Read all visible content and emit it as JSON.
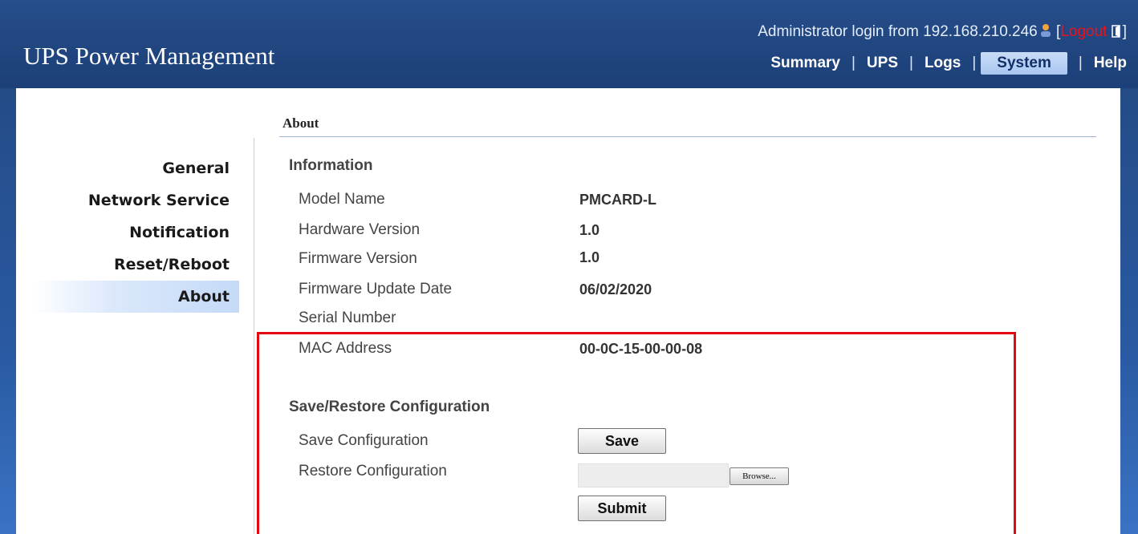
{
  "app": {
    "title": "UPS Power Management"
  },
  "header": {
    "login_prefix": "Administrator login from 192.168.210.246",
    "bracket_open": "[",
    "logout": "Logout",
    "bracket_close": "]"
  },
  "nav": {
    "items": [
      {
        "label": "Summary"
      },
      {
        "label": "UPS"
      },
      {
        "label": "Logs"
      },
      {
        "label": "System"
      },
      {
        "label": "Help"
      }
    ],
    "active": "System"
  },
  "sidebar": {
    "items": [
      {
        "label": "General"
      },
      {
        "label": "Network Service"
      },
      {
        "label": "Notification"
      },
      {
        "label": "Reset/Reboot"
      },
      {
        "label": "About"
      }
    ],
    "active": "About"
  },
  "page": {
    "title": "About"
  },
  "information": {
    "heading": "Information",
    "rows": [
      {
        "label": "Model Name",
        "value": "PMCARD-L"
      },
      {
        "label": "Hardware Version",
        "value": "1.0"
      },
      {
        "label": "Firmware Version",
        "value": "1.0"
      },
      {
        "label": "Firmware Update Date",
        "value": "06/02/2020"
      },
      {
        "label": "Serial Number",
        "value": ""
      },
      {
        "label": "MAC Address",
        "value": "00-0C-15-00-00-08"
      }
    ]
  },
  "config": {
    "heading": "Save/Restore Configuration",
    "save_label": "Save Configuration",
    "save_button": "Save",
    "restore_label": "Restore Configuration",
    "restore_file_value": "",
    "browse_button": "Browse...",
    "submit_button": "Submit"
  },
  "colors": {
    "header_bg": "#1c3f78",
    "active_tab_bg": "#c9dcf8",
    "highlight_border": "#e4070f",
    "logout_text": "#e8131b"
  },
  "icons": {
    "user": "user-icon",
    "exit": "exit-icon"
  }
}
